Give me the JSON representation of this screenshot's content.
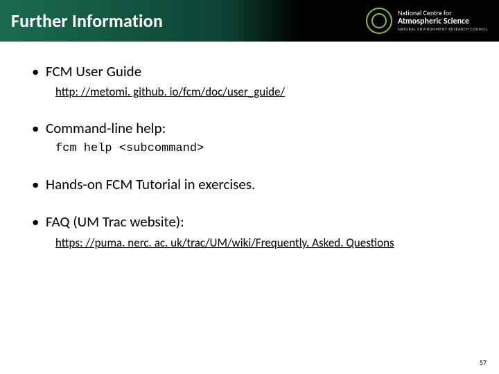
{
  "header": {
    "title": "Further Information",
    "brand": {
      "line1": "National Centre for",
      "line2": "Atmospheric Science",
      "line3": "NATURAL ENVIRONMENT RESEARCH COUNCIL"
    }
  },
  "bullets": [
    {
      "text": "FCM User Guide",
      "sub_text": "http: //metomi. github. io/fcm/doc/user_guide/",
      "sub_kind": "link"
    },
    {
      "text": "Command-line help:",
      "sub_text": "fcm help <subcommand>",
      "sub_kind": "mono"
    },
    {
      "text": "Hands-on FCM Tutorial in exercises.",
      "sub_text": null,
      "sub_kind": null
    },
    {
      "text": "FAQ (UM Trac website):",
      "sub_text": "https: //puma. nerc. ac. uk/trac/UM/wiki/Frequently. Asked. Questions",
      "sub_kind": "link"
    }
  ],
  "page_number": "57"
}
